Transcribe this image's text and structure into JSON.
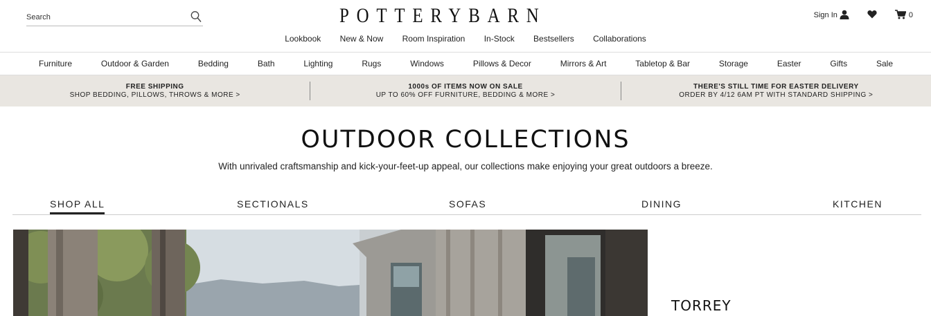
{
  "header": {
    "search_placeholder": "Search",
    "logo": "POTTERYBARN",
    "sign_in": "Sign In",
    "cart_count": "0"
  },
  "util_nav": [
    "Lookbook",
    "New & Now",
    "Room Inspiration",
    "In-Stock",
    "Bestsellers",
    "Collaborations"
  ],
  "categories": [
    "Furniture",
    "Outdoor & Garden",
    "Bedding",
    "Bath",
    "Lighting",
    "Rugs",
    "Windows",
    "Pillows & Decor",
    "Mirrors & Art",
    "Tabletop & Bar",
    "Storage",
    "Easter",
    "Gifts",
    "Sale"
  ],
  "promos": [
    {
      "title": "FREE SHIPPING",
      "sub": "SHOP BEDDING, PILLOWS, THROWS & MORE >"
    },
    {
      "title": "1000s OF ITEMS NOW ON SALE",
      "sub": "UP TO 60% OFF FURNITURE, BEDDING & MORE >"
    },
    {
      "title": "THERE'S STILL TIME FOR EASTER DELIVERY",
      "sub": "ORDER BY 4/12 6AM PT WITH STANDARD SHIPPING >"
    }
  ],
  "hero": {
    "title": "OUTDOOR COLLECTIONS",
    "subtitle": "With unrivaled craftsmanship and kick-your-feet-up appeal, our collections make enjoying your great outdoors a breeze."
  },
  "tabs": [
    "SHOP ALL",
    "SECTIONALS",
    "SOFAS",
    "DINING",
    "KITCHEN"
  ],
  "feature": {
    "title": "TORREY"
  }
}
